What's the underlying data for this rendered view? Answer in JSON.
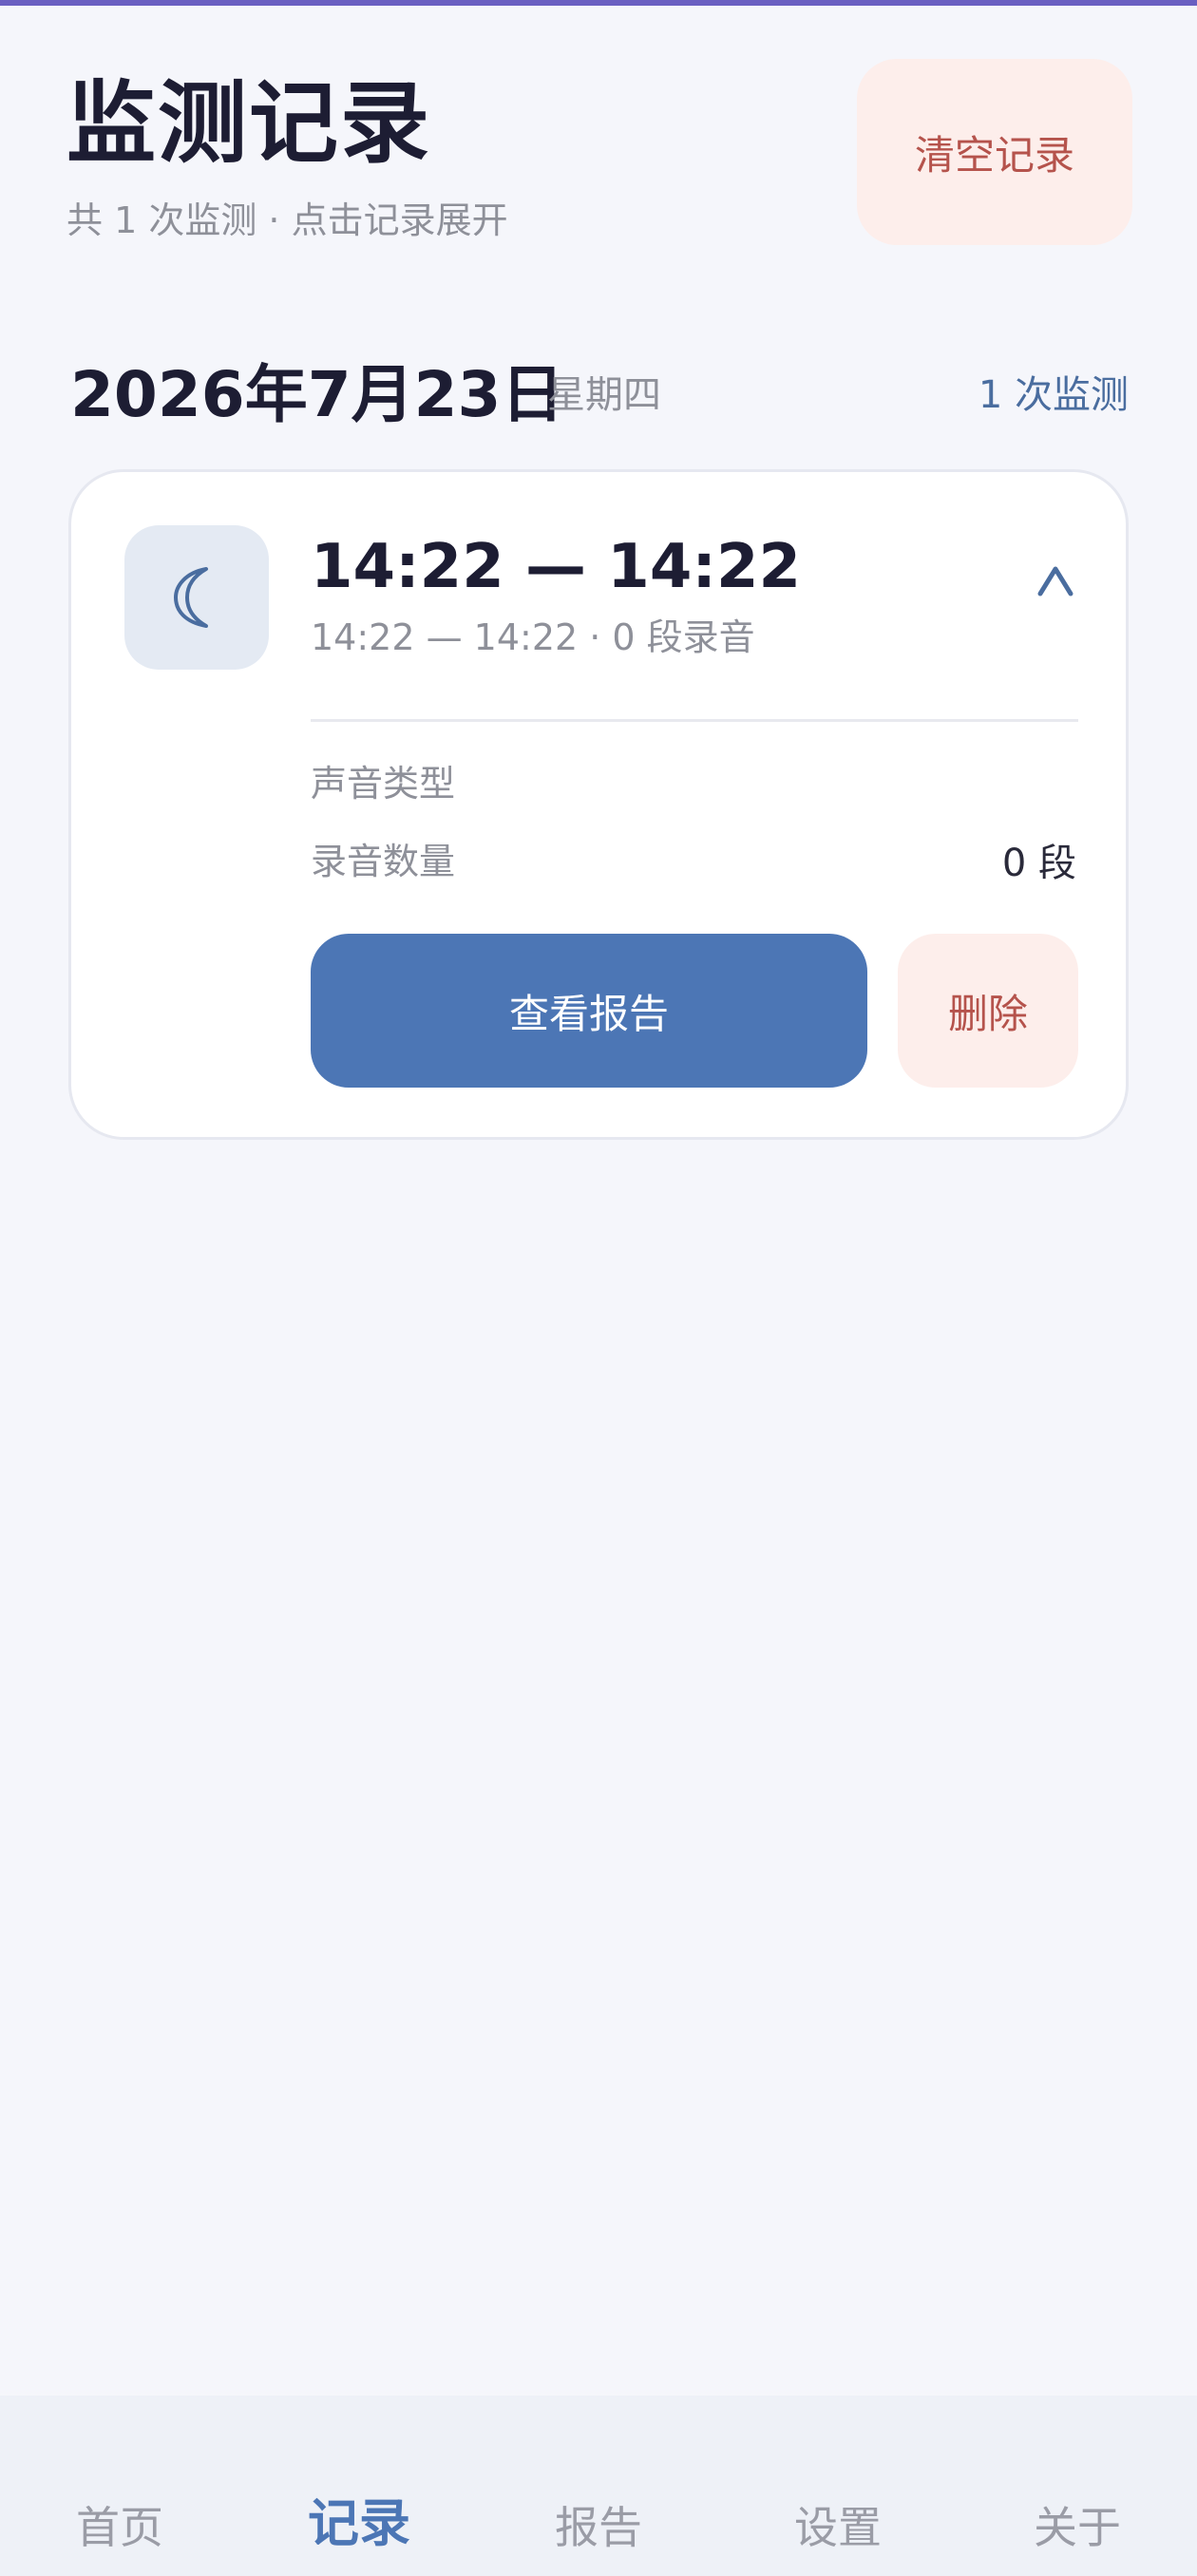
{
  "header": {
    "title": "监测记录",
    "subtitle": "共 1 次监测 · 点击记录展开",
    "clear_label": "清空记录"
  },
  "date_group": {
    "date": "2026年7月23日",
    "weekday": "星期四",
    "count": "1 次监测"
  },
  "record": {
    "icon": "moon-icon",
    "time_range": "14:22 — 14:22",
    "meta": "14:22 — 14:22 · 0 段录音",
    "expanded": true,
    "details": {
      "sound_type_label": "声音类型",
      "sound_type_value": "",
      "recording_count_label": "录音数量",
      "recording_count_value": "0 段"
    },
    "view_report_label": "查看报告",
    "delete_label": "删除"
  },
  "nav": {
    "items": [
      {
        "label": "首页",
        "active": false
      },
      {
        "label": "记录",
        "active": true
      },
      {
        "label": "报告",
        "active": false
      },
      {
        "label": "设置",
        "active": false
      },
      {
        "label": "关于",
        "active": false
      }
    ]
  },
  "colors": {
    "accent": "#4c76b5",
    "danger": "#b5534c",
    "danger_bg": "#fdeeeb",
    "top_bar": "#6a5fc1"
  }
}
